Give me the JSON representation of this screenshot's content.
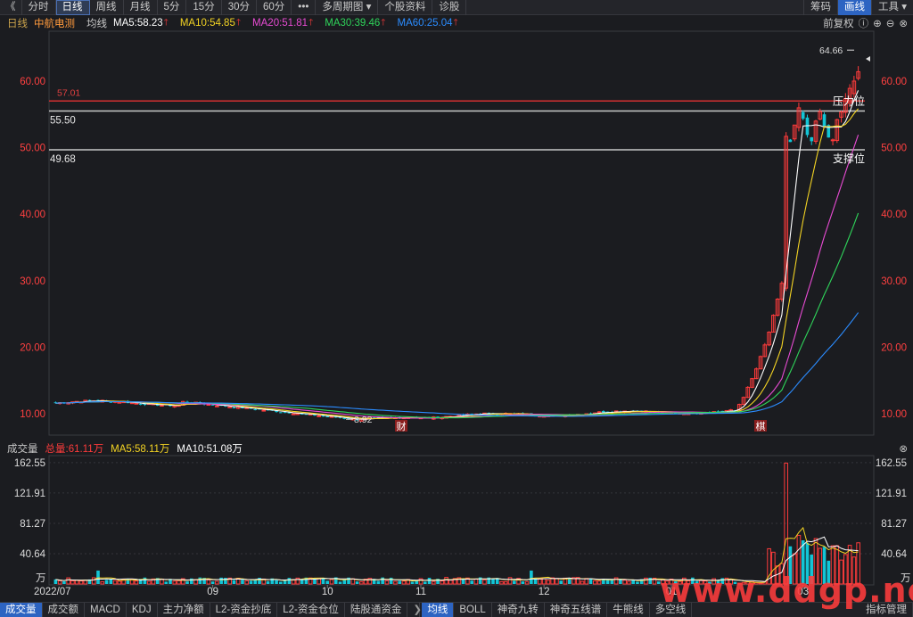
{
  "toolbar": {
    "back": "《",
    "items": [
      "分时",
      "日线",
      "周线",
      "月线",
      "5分",
      "15分",
      "30分",
      "60分",
      "•••",
      "多周期图",
      "个股资料",
      "诊股"
    ],
    "active": "日线",
    "right": [
      "筹码",
      "画线",
      "工具"
    ],
    "right_selected": "画线"
  },
  "indicator": {
    "period": "日线",
    "stock": "中航电测",
    "ma_type": "均线",
    "ma5": "MA5:58.23",
    "ma10": "MA10:54.85",
    "ma20": "MA20:51.81",
    "ma30": "MA30:39.46",
    "ma60": "MA60:25.04",
    "adjust": "前复权",
    "colors": {
      "ma5": "#ffffff",
      "ma10": "#f4d423",
      "ma20": "#e84bd3",
      "ma30": "#2fd45a",
      "ma60": "#2b8cff",
      "up": "#ff3b3b",
      "down": "#12c5d6"
    }
  },
  "annotations": {
    "line_5701": "57.01",
    "line_5550": "55.50",
    "line_4968": "49.68",
    "pressure": "压力位",
    "support": "支撑位",
    "high": "64.66",
    "low": "8.92",
    "marker_cai": "财",
    "marker_ji": "棋"
  },
  "volume": {
    "title": "成交量",
    "total": "总量:61.11万",
    "ma5": "MA5:58.11万",
    "ma10": "MA10:51.08万",
    "unit": "万",
    "y_ticks": [
      "162.55",
      "121.91",
      "81.27",
      "40.64"
    ]
  },
  "xaxis": [
    "2022/07",
    "09",
    "10",
    "11",
    "12",
    "01",
    "03"
  ],
  "tabs": [
    "成交量",
    "成交额",
    "MACD",
    "KDJ",
    "主力净额",
    "L2-资金抄底",
    "L2-资金仓位",
    "陆股通资金",
    "均线",
    "BOLL",
    "神奇九转",
    "神奇五线谱",
    "牛熊线",
    "多空线",
    "指标管理"
  ],
  "watermark": "www.ddgp.net",
  "chart_data": {
    "type": "candlestick",
    "y_ticks": [
      10,
      20,
      30,
      40,
      50,
      60
    ],
    "y_tick_labels": [
      "10.00",
      "20.00",
      "30.00",
      "40.00",
      "50.00",
      "60.00"
    ],
    "ylim": [
      6.8,
      67.5
    ],
    "levels": [
      57.01,
      55.5,
      49.68
    ],
    "high": 64.66,
    "low": 8.92,
    "series": [
      {
        "name": "MA5",
        "value": 58.23
      },
      {
        "name": "MA10",
        "value": 54.85
      },
      {
        "name": "MA20",
        "value": 51.81
      },
      {
        "name": "MA30",
        "value": 39.46
      },
      {
        "name": "MA60",
        "value": 25.04
      }
    ],
    "volume_total": 61.11,
    "volume_ma5": 58.11,
    "volume_ma10": 51.08,
    "volume_ylim": [
      0,
      172
    ]
  }
}
